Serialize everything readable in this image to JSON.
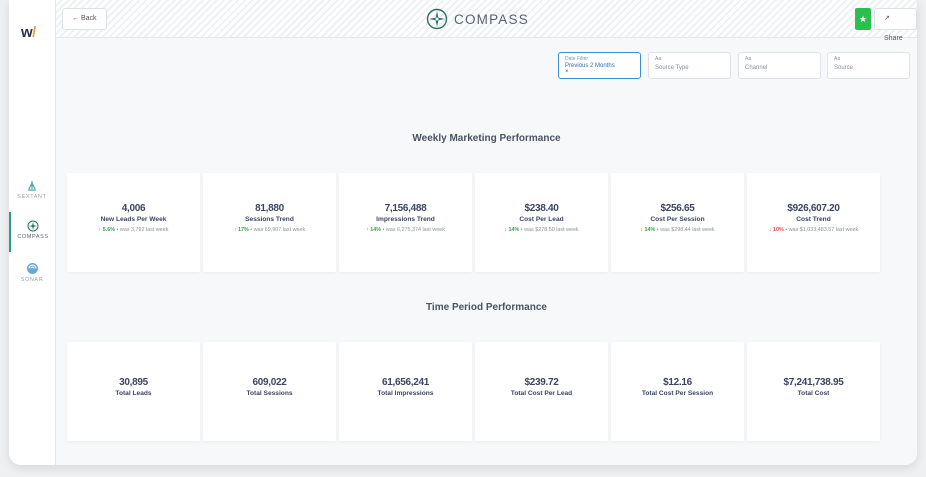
{
  "sidebar": {
    "logo": "w",
    "logo_slash": "/",
    "items": [
      {
        "label": "SEXTANT",
        "icon": "sextant-icon"
      },
      {
        "label": "COMPASS",
        "icon": "compass-icon"
      },
      {
        "label": "SONAR",
        "icon": "sonar-icon"
      }
    ]
  },
  "header": {
    "back_label": "← Back",
    "brand": "COMPASS",
    "star_icon": "★",
    "share_label": "↗ Share"
  },
  "filters": [
    {
      "label": "Date Filter",
      "value": "Previous 2 Months",
      "clear": "×"
    },
    {
      "label": "Aa",
      "value": "Source Type"
    },
    {
      "label": "Aa",
      "value": "Channel"
    },
    {
      "label": "Aa",
      "value": "Source"
    }
  ],
  "weekly": {
    "title": "Weekly Marketing Performance",
    "cards": [
      {
        "value": "4,006",
        "label": "New Leads Per Week",
        "arrow": "↑",
        "pct": "5.6%",
        "was": "• was 3,792 last week",
        "tone": "up"
      },
      {
        "value": "81,880",
        "label": "Sessions Trend",
        "arrow": "↑",
        "pct": "17%",
        "was": "• was 69,907 last week",
        "tone": "up"
      },
      {
        "value": "7,156,488",
        "label": "Impressions Trend",
        "arrow": "↑",
        "pct": "14%",
        "was": "• was 6,275,374 last week",
        "tone": "up"
      },
      {
        "value": "$238.40",
        "label": "Cost Per Lead",
        "arrow": "↓",
        "pct": "14%",
        "was": "• was $278.50 last week",
        "tone": "good"
      },
      {
        "value": "$256.65",
        "label": "Cost Per Session",
        "arrow": "↓",
        "pct": "14%",
        "was": "• was $298.44 last week",
        "tone": "good"
      },
      {
        "value": "$926,607.20",
        "label": "Cost Trend",
        "arrow": "↓",
        "pct": "10%",
        "was": "• was $1,033,483.57 last week",
        "tone": "down"
      }
    ]
  },
  "period": {
    "title": "Time Period Performance",
    "cards": [
      {
        "value": "30,895",
        "label": "Total Leads"
      },
      {
        "value": "609,022",
        "label": "Total Sessions"
      },
      {
        "value": "61,656,241",
        "label": "Total Impressions"
      },
      {
        "value": "$239.72",
        "label": "Total Cost Per Lead"
      },
      {
        "value": "$12.16",
        "label": "Total Cost Per Session"
      },
      {
        "value": "$7,241,738.95",
        "label": "Total Cost"
      }
    ]
  },
  "colors": {
    "accent": "#2e9b8a",
    "star_button": "#2cbf4f",
    "trend_good": "#3aa14b",
    "trend_bad": "#e04b4b",
    "filter_active": "#3b8fd4"
  }
}
